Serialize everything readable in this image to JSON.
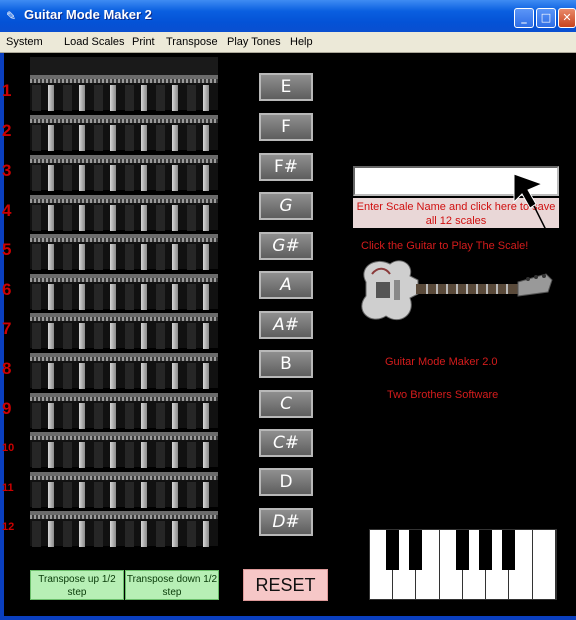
{
  "window": {
    "title": "Guitar Mode Maker 2",
    "controls": [
      "minimize-icon",
      "maximize-icon",
      "close-icon"
    ]
  },
  "menu": [
    "System",
    "Load Scales",
    "Print",
    "Transpose",
    "Play Tones",
    "Help"
  ],
  "fretboard": {
    "fret_numbers": [
      "1",
      "2",
      "3",
      "4",
      "5",
      "6",
      "7",
      "8",
      "9",
      "10",
      "11",
      "12"
    ]
  },
  "notes": [
    "E",
    "F",
    "F#",
    "G",
    "G#",
    "A",
    "A#",
    "B",
    "C",
    "C#",
    "D",
    "D#"
  ],
  "scale_name_input": {
    "value": "",
    "placeholder": ""
  },
  "save_hint": "Enter Scale Name and click here to save all 12 scales",
  "guitar_hint": "Click the Guitar to Play The Scale!",
  "app_name": "Guitar Mode Maker 2.0",
  "company": "Two Brothers Software",
  "buttons": {
    "transpose_up": "Transpose up 1/2 step",
    "transpose_down": "Transpose down 1/2 step",
    "reset": "RESET"
  },
  "colors": {
    "accent_red": "#d41c1c",
    "transpose_green": "#b7efb5",
    "reset_pink": "#f6c7c7"
  }
}
